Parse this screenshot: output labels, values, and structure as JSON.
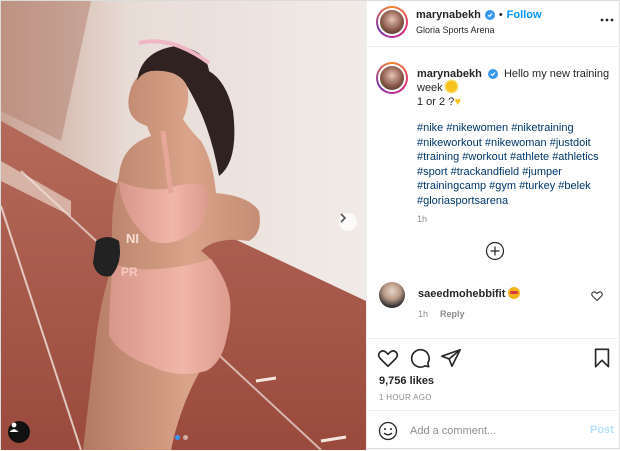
{
  "header": {
    "username": "marynabekh",
    "separator": "•",
    "follow_label": "Follow",
    "location": "Gloria Sports Arena"
  },
  "caption": {
    "username": "marynabekh",
    "text_line1": "Hello my new training week",
    "text_line2": "1 or 2 ?",
    "hashtags": [
      "#nike",
      "#nikewomen",
      "#niketraining",
      "#nikeworkout",
      "#nikewoman",
      "#justdoit",
      "#training",
      "#workout",
      "#athlete",
      "#athletics",
      "#sport",
      "#trackandfield",
      "#jumper",
      "#trainingcamp",
      "#gym",
      "#turkey",
      "#belek",
      "#gloriasportsarena"
    ],
    "time": "1h"
  },
  "comment": {
    "username": "saeedmohebbifit",
    "time": "1h",
    "reply_label": "Reply"
  },
  "post": {
    "likes": "9,756 likes",
    "timestamp": "1 HOUR AGO"
  },
  "add_comment": {
    "placeholder": "Add a comment...",
    "post_label": "Post"
  },
  "carousel": {
    "current": 1,
    "total": 2
  },
  "colors": {
    "accent": "#0095f6",
    "verified": "#3897f0",
    "hashtag": "#00376b",
    "muted": "#8e8e8e",
    "post_disabled": "#b2dffc"
  },
  "icons": [
    "verified-badge-icon",
    "more-options-icon",
    "load-more-comments-icon",
    "heart-icon",
    "comment-icon",
    "share-icon",
    "bookmark-icon",
    "emoji-icon",
    "chevron-right-icon",
    "user-tag-icon"
  ]
}
